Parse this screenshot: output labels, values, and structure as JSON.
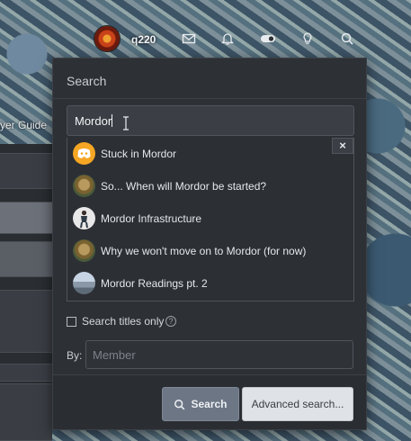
{
  "background": {
    "guide_text": "yer Guide"
  },
  "topbar": {
    "username": "q220",
    "icons": [
      "avatar",
      "mail-icon",
      "bell-icon",
      "toggle-icon",
      "lightbulb-icon",
      "search-icon"
    ]
  },
  "search": {
    "title": "Search",
    "query": "Mordor",
    "close_label": "×",
    "suggestions": [
      {
        "label": "Stuck in Mordor",
        "avatar": "discord-avatar"
      },
      {
        "label": "So... When will Mordor be started?",
        "avatar": "owl-avatar"
      },
      {
        "label": "Mordor Infrastructure",
        "avatar": "person-avatar"
      },
      {
        "label": "Why we won't move on to Mordor (for now)",
        "avatar": "owl-avatar"
      },
      {
        "label": "Mordor Readings pt. 2",
        "avatar": "landscape-avatar"
      }
    ],
    "titles_only_label": "Search titles only",
    "help_glyph": "?",
    "by_label": "By:",
    "member_placeholder": "Member",
    "search_button": "Search",
    "advanced_button": "Advanced search..."
  },
  "colors": {
    "panel_bg": "#2d3035",
    "search_button_bg": "#6c7685",
    "advanced_button_bg": "#dfe2e6",
    "discord_avatar": "#f5a623"
  }
}
